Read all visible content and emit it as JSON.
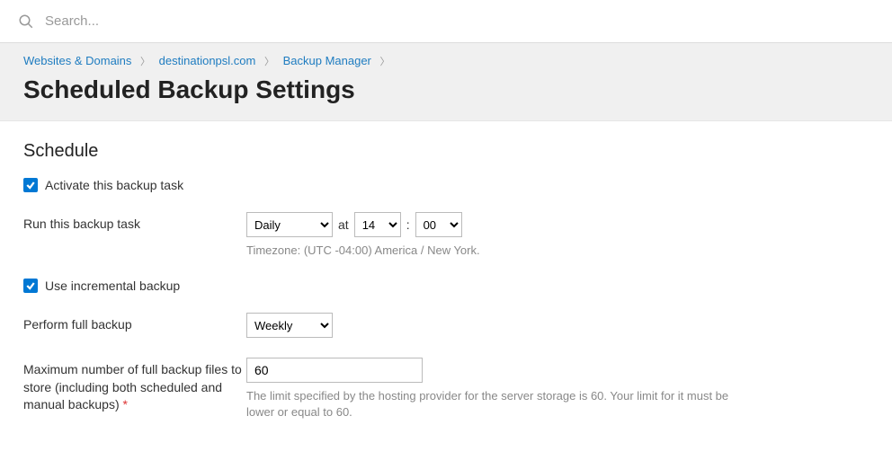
{
  "search": {
    "placeholder": "Search..."
  },
  "breadcrumb": {
    "item1": "Websites & Domains",
    "item2": "destinationpsl.com",
    "item3": "Backup Manager"
  },
  "page_title": "Scheduled Backup Settings",
  "section_title": "Schedule",
  "activate": {
    "label": "Activate this backup task"
  },
  "run_task": {
    "label": "Run this backup task",
    "frequency": "Daily",
    "at": "at",
    "hour": "14",
    "colon": ":",
    "minute": "00",
    "timezone": "Timezone: (UTC -04:00) America / New York."
  },
  "incremental": {
    "label": "Use incremental backup"
  },
  "full_backup": {
    "label": "Perform full backup",
    "value": "Weekly"
  },
  "max_files": {
    "label": "Maximum number of full backup files to store (including both scheduled and manual backups) ",
    "value": "60",
    "hint": "The limit specified by the hosting provider for the server storage is 60. Your limit for it must be lower or equal to 60."
  },
  "required_mark": "*"
}
